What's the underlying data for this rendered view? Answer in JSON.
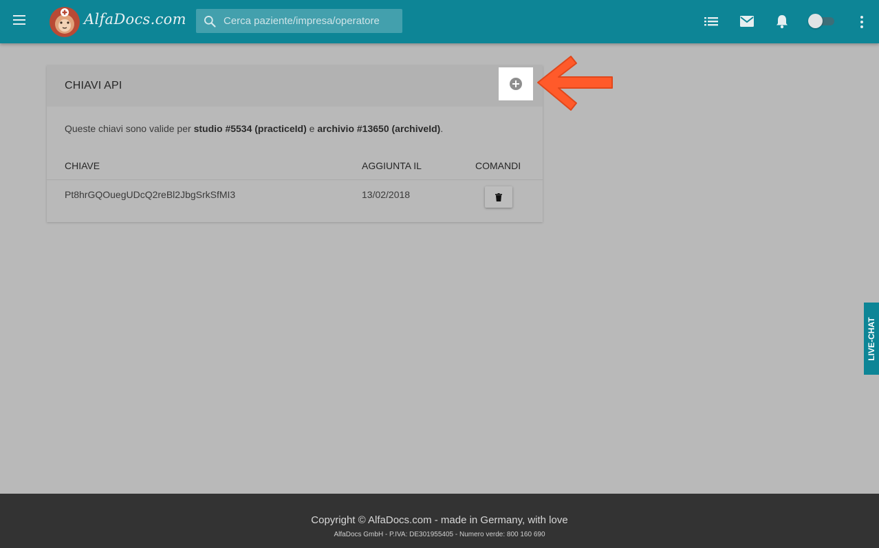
{
  "header": {
    "logo_text": "AlfaDocs.com",
    "search_placeholder": "Cerca paziente/impresa/operatore",
    "icons": [
      "menu-icon",
      "list-icon",
      "mail-icon",
      "bell-icon",
      "toggle-switch",
      "more-vert-icon"
    ],
    "brand_color": "#0d8596"
  },
  "card": {
    "title": "CHIAVI API",
    "description": {
      "pre": "Queste chiavi sono valide per ",
      "studio": "studio #5534 (practiceId)",
      "mid": " e ",
      "archivio": "archivio #13650 (archiveId)",
      "post": "."
    },
    "columns": [
      "CHIAVE",
      "AGGIUNTA IL",
      "COMANDI"
    ],
    "rows": [
      {
        "key": "Pt8hrGQOuegUDcQ2reBl2JbgSrkSfMI3",
        "added": "13/02/2018",
        "command_icon": "trash-icon"
      }
    ],
    "add_button_icon": "plus-circle-icon",
    "highlight_arrow_color": "#ff5a2a"
  },
  "livechat": {
    "label": "LIVE-CHAT"
  },
  "footer": {
    "copyright": "Copyright © AlfaDocs.com - made in Germany, with love",
    "legal": "AlfaDocs GmbH - P.IVA: DE301955405 - Numero verde: 800 160 690"
  }
}
